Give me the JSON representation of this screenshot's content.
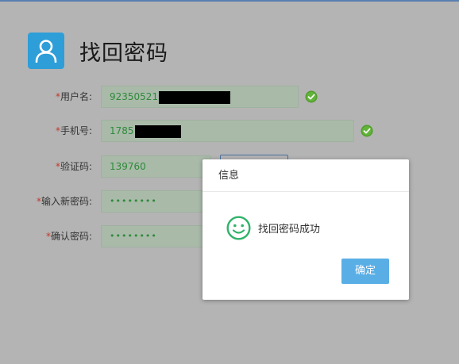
{
  "page": {
    "title": "找回密码",
    "accent_color": "#2e9ed8"
  },
  "form": {
    "required_mark": "*",
    "username": {
      "label": "用户名:",
      "value": "92350521",
      "redacted": true,
      "valid": true
    },
    "phone": {
      "label": "手机号:",
      "value": "1785",
      "redacted": true,
      "valid": true
    },
    "code": {
      "label": "验证码:",
      "value": "139760"
    },
    "new_password": {
      "label": "输入新密码:",
      "value": "••••••••"
    },
    "confirm_password": {
      "label": "确认密码:",
      "value": "••••••••"
    },
    "icons": {
      "valid": "check-circle-icon",
      "user": "user-icon"
    }
  },
  "dialog": {
    "title": "信息",
    "message": "找回密码成功",
    "icon": "smile-icon",
    "ok_label": "确定",
    "ok_color": "#5aaee6"
  }
}
